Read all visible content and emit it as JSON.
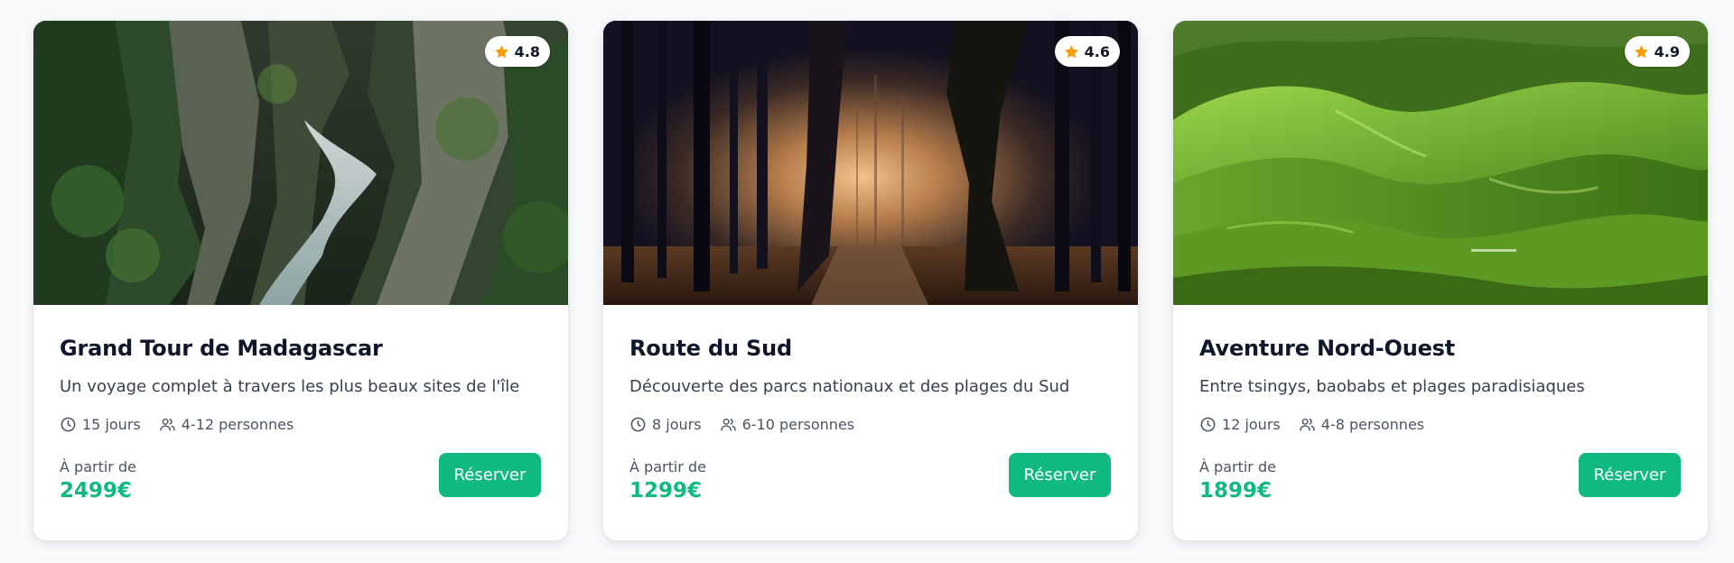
{
  "colors": {
    "accent": "#10b981",
    "star": "#f59e0b",
    "text_primary": "#0f172a",
    "text_secondary": "#4b5563"
  },
  "tours": [
    {
      "image_subject": "mossy-canyon-river",
      "rating": "4.8",
      "title": "Grand Tour de Madagascar",
      "description": "Un voyage complet à travers les plus beaux sites de l'île",
      "duration": "15 jours",
      "group_size": "4-12 personnes",
      "price_label": "À partir de",
      "price": "2499€",
      "button_label": "Réserver"
    },
    {
      "image_subject": "misty-forest-path",
      "rating": "4.6",
      "title": "Route du Sud",
      "description": "Découverte des parcs nationaux et des plages du Sud",
      "duration": "8 jours",
      "group_size": "6-10 personnes",
      "price_label": "À partir de",
      "price": "1299€",
      "button_label": "Réserver"
    },
    {
      "image_subject": "green-rolling-hills",
      "rating": "4.9",
      "title": "Aventure Nord-Ouest",
      "description": "Entre tsingys, baobabs et plages paradisiaques",
      "duration": "12 jours",
      "group_size": "4-8 personnes",
      "price_label": "À partir de",
      "price": "1899€",
      "button_label": "Réserver"
    }
  ]
}
